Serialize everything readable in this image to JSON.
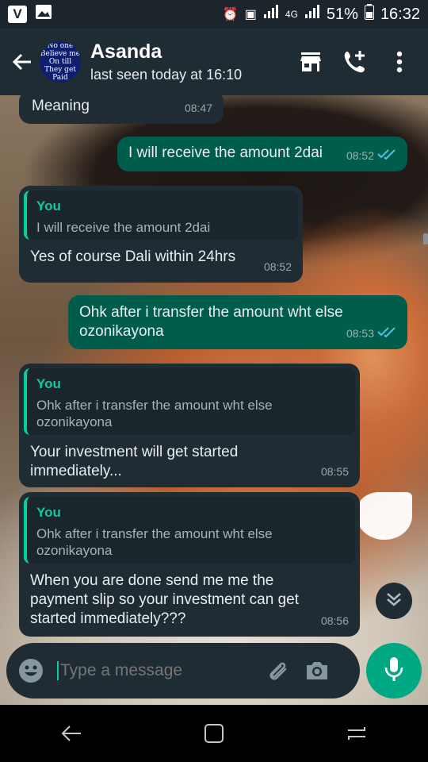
{
  "status_bar": {
    "app_icon_1": "V",
    "signal_label": "4G",
    "battery": "51%",
    "time": "16:32"
  },
  "header": {
    "avatar_text": [
      "No one",
      "Believe me",
      "On till",
      "They get",
      "Paid"
    ],
    "contact_name": "Asanda",
    "last_seen": "last seen today at 16:10",
    "icons": [
      "back-arrow-icon",
      "store-icon",
      "add-call-icon",
      "more-vert-icon"
    ]
  },
  "messages": [
    {
      "type": "in",
      "text": "Meaning",
      "time": "08:47"
    },
    {
      "type": "out",
      "text": "I will receive the amount 2dai",
      "time": "08:52",
      "ticks": "✓✓"
    },
    {
      "type": "in",
      "quote_author": "You",
      "quote_text": "I will receive the amount 2dai",
      "text": "Yes of course Dali within 24hrs",
      "time": "08:52"
    },
    {
      "type": "out",
      "text": "Ohk after i transfer the amount wht else ozonikayona",
      "time": "08:53",
      "ticks": "✓✓"
    },
    {
      "type": "in",
      "quote_author": "You",
      "quote_text": "Ohk after i transfer the amount wht else ozonikayona",
      "text": "Your investment will get started immediately...",
      "time": "08:55"
    },
    {
      "type": "in",
      "quote_author": "You",
      "quote_text": "Ohk after i transfer the amount wht else ozonikayona",
      "text": "When you are done send me me the payment slip so your investment can get started immediately???",
      "time": "08:56"
    }
  ],
  "input": {
    "placeholder": "Type a message"
  },
  "colors": {
    "incoming": "#1f2c34",
    "outgoing": "#005c4b",
    "accent": "#00a884",
    "tick_blue": "#53bdeb"
  }
}
